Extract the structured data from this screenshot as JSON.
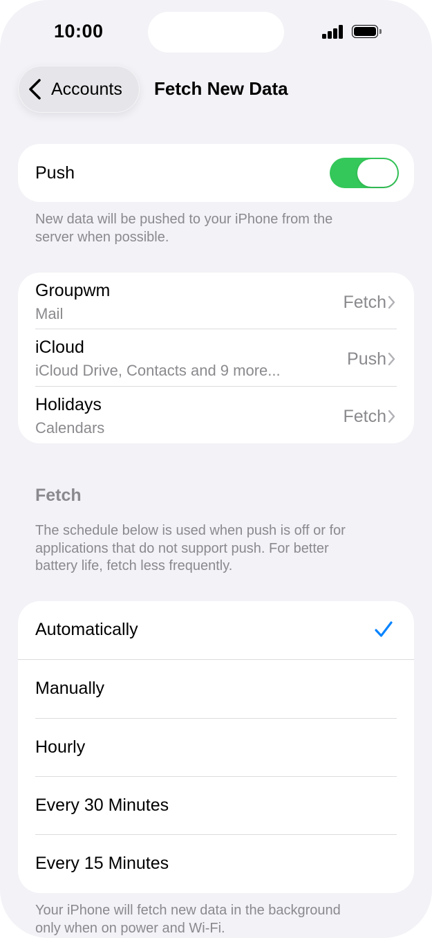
{
  "status_bar": {
    "time": "10:00"
  },
  "nav": {
    "back_label": "Accounts",
    "title": "Fetch New Data"
  },
  "push": {
    "label": "Push",
    "enabled": true,
    "footnote_line1": "New data will be pushed to your iPhone from the",
    "footnote_line2": "server when possible."
  },
  "accounts": [
    {
      "name": "Groupwm",
      "detail": "Mail",
      "value": "Fetch"
    },
    {
      "name": "iCloud",
      "detail": "iCloud Drive, Contacts and 9 more...",
      "value": "Push"
    },
    {
      "name": "Holidays",
      "detail": "Calendars",
      "value": "Fetch"
    }
  ],
  "fetch_section": {
    "header": "Fetch",
    "description_line1": "The schedule below is used when push is off or for",
    "description_line2": "applications that do not support push. For better",
    "description_line3": "battery life, fetch less frequently."
  },
  "options": [
    {
      "label": "Automatically",
      "selected": true
    },
    {
      "label": "Manually",
      "selected": false
    },
    {
      "label": "Hourly",
      "selected": false
    },
    {
      "label": "Every 30 Minutes",
      "selected": false
    },
    {
      "label": "Every 15 Minutes",
      "selected": false
    }
  ],
  "bottom_note": {
    "line1": "Your iPhone will fetch new data in the background",
    "line2": "only when on power and Wi-Fi."
  },
  "colors": {
    "toggle_on": "#34c759",
    "checkmark": "#0a84ff",
    "secondary_text": "#8a8a8e",
    "grouped_background": "#f2f2f7"
  },
  "icons": {
    "back": "chevron-left-icon",
    "disclosure": "chevron-right-icon",
    "selected": "checkmark-icon",
    "signal": "cellular-signal-icon",
    "battery": "battery-icon"
  }
}
